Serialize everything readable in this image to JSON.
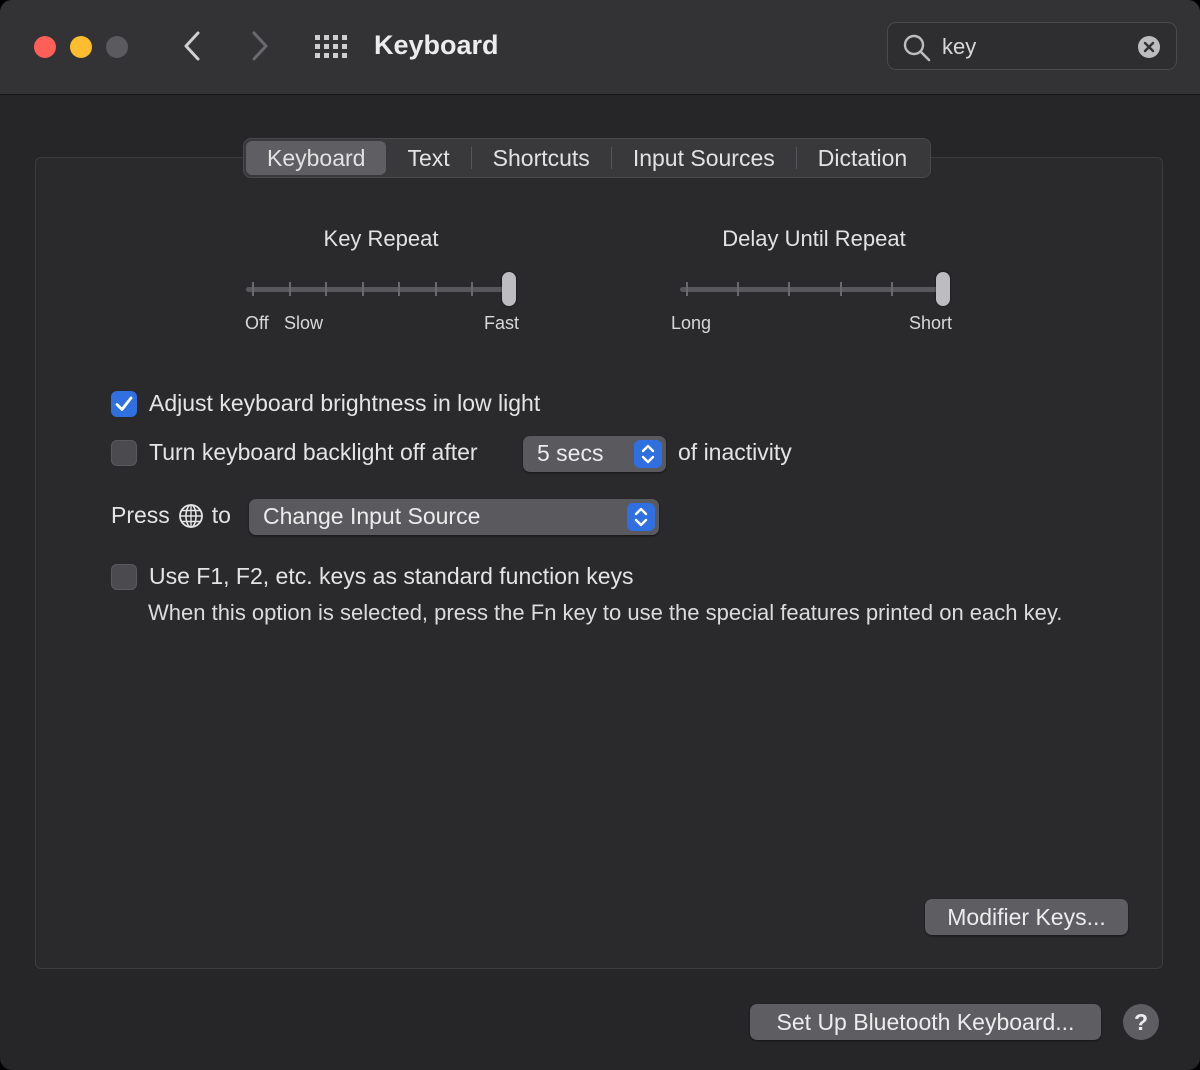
{
  "window": {
    "title": "Keyboard"
  },
  "search": {
    "value": "key"
  },
  "tabs": [
    {
      "label": "Keyboard",
      "active": true
    },
    {
      "label": "Text",
      "active": false
    },
    {
      "label": "Shortcuts",
      "active": false
    },
    {
      "label": "Input Sources",
      "active": false
    },
    {
      "label": "Dictation",
      "active": false
    }
  ],
  "key_repeat": {
    "title": "Key Repeat",
    "label_off": "Off",
    "label_slow": "Slow",
    "label_fast": "Fast",
    "steps": 8,
    "value_step": 8
  },
  "delay_until_repeat": {
    "title": "Delay Until Repeat",
    "label_long": "Long",
    "label_short": "Short",
    "steps": 6,
    "value_step": 6
  },
  "options": {
    "adjust_brightness": {
      "label": "Adjust keyboard brightness in low light",
      "checked": true
    },
    "backlight_off": {
      "label": "Turn keyboard backlight off after",
      "checked": false,
      "value": "5 secs",
      "suffix": "of inactivity"
    },
    "press_globe": {
      "prefix": "Press",
      "suffix": "to",
      "value": "Change Input Source"
    },
    "function_keys": {
      "label": "Use F1, F2, etc. keys as standard function keys",
      "checked": false,
      "description": "When this option is selected, press the Fn key to use the special features printed on each key."
    }
  },
  "buttons": {
    "modifier_keys": "Modifier Keys...",
    "bluetooth": "Set Up Bluetooth Keyboard...",
    "help": "?"
  },
  "colors": {
    "accent": "#2f6fe0",
    "close": "#ff5f57",
    "minimize": "#febc2e"
  }
}
